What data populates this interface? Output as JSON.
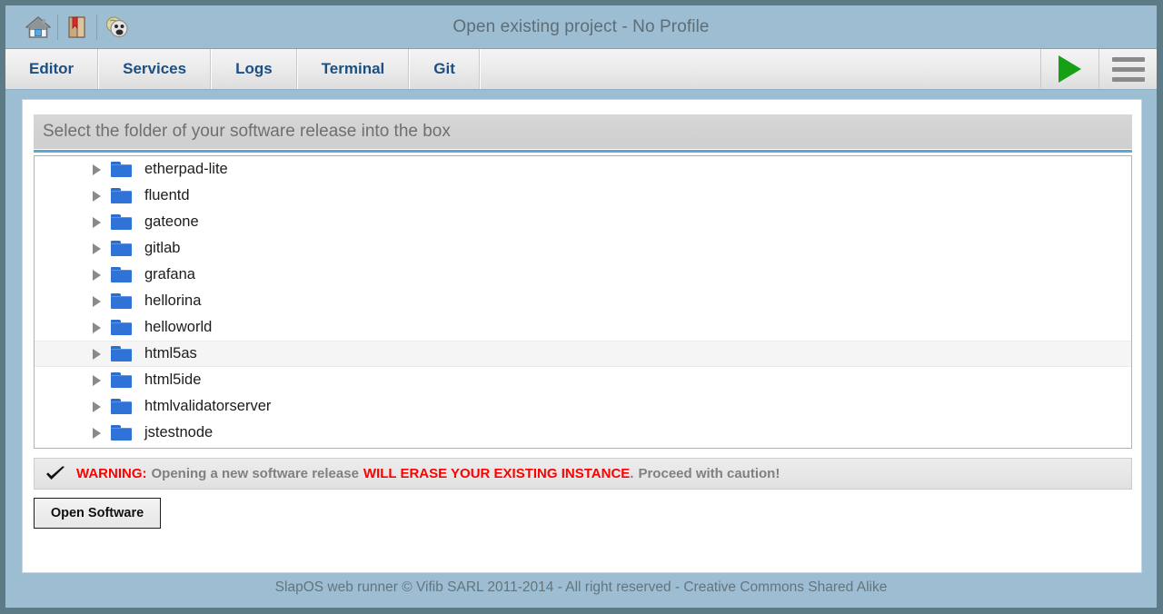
{
  "window": {
    "title": "Open existing project - No Profile",
    "toolbar_icons": [
      {
        "name": "home-icon",
        "glyph": "home"
      },
      {
        "name": "bookmark-icon",
        "glyph": "bookmark"
      },
      {
        "name": "mask-face-icon",
        "glyph": "mask"
      }
    ]
  },
  "nav": {
    "tabs": [
      {
        "label": "Editor"
      },
      {
        "label": "Services"
      },
      {
        "label": "Logs"
      },
      {
        "label": "Terminal"
      },
      {
        "label": "Git"
      }
    ],
    "run_button": {
      "name": "run-button",
      "icon": "play-icon"
    },
    "menu_button": {
      "name": "menu-button",
      "icon": "hamburger-icon"
    }
  },
  "main": {
    "panel_header": "Select the folder of your software release into the box",
    "tree": {
      "items": [
        {
          "label": "etherpad-lite",
          "selected": false
        },
        {
          "label": "fluentd",
          "selected": false
        },
        {
          "label": "gateone",
          "selected": false
        },
        {
          "label": "gitlab",
          "selected": false
        },
        {
          "label": "grafana",
          "selected": false
        },
        {
          "label": "hellorina",
          "selected": false
        },
        {
          "label": "helloworld",
          "selected": false
        },
        {
          "label": "html5as",
          "selected": true
        },
        {
          "label": "html5ide",
          "selected": false
        },
        {
          "label": "htmlvalidatorserver",
          "selected": false
        },
        {
          "label": "jstestnode",
          "selected": false
        }
      ]
    },
    "warning": {
      "icon": "check-icon",
      "prefix": "WARNING:",
      "text_one": "Opening a new software release",
      "emphasis": "WILL ERASE YOUR EXISTING INSTANCE",
      "period": ".",
      "text_two": "Proceed with caution!"
    },
    "open_software_label": "Open Software"
  },
  "footer": {
    "text": "SlapOS web runner © Vifib SARL 2011-2014 - All right reserved - Creative Commons Shared Alike"
  },
  "colors": {
    "frame": "#5c7b86",
    "chrome": "#9dbdd3",
    "nav_text": "#1c4f82",
    "accent_rule": "#5aa8d8",
    "run_green": "#15a015",
    "warning_red": "#ff0000",
    "warning_gray": "#808080",
    "folder_blue": "#2f73d8"
  }
}
